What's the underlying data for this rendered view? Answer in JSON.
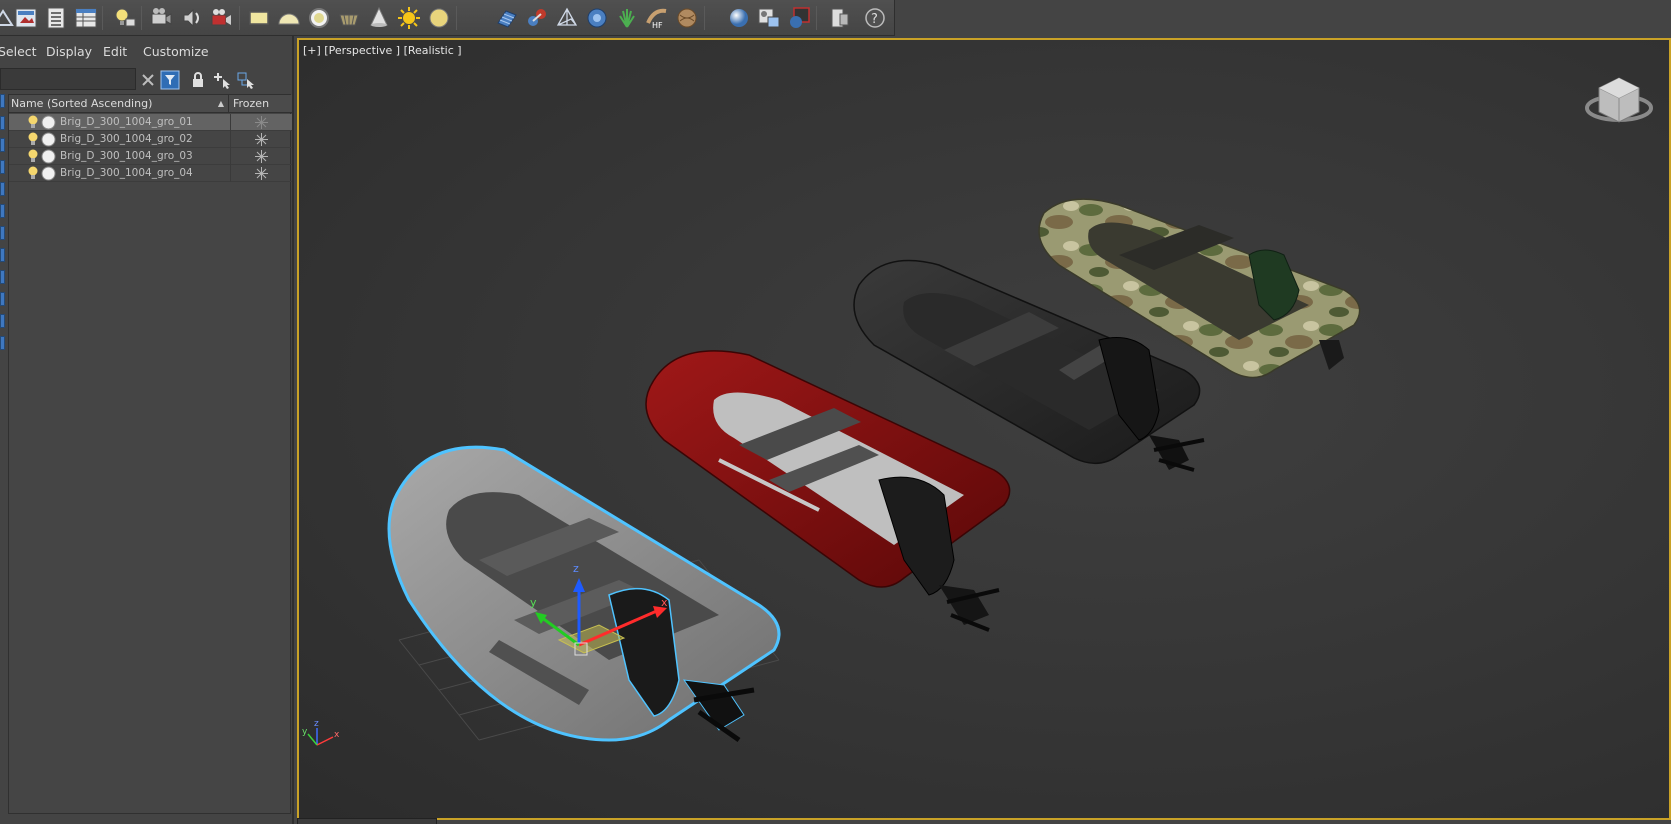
{
  "toolbar": {
    "icons": [
      "create-icon",
      "render-frame-icon",
      "list-icon",
      "grid-list-icon",
      "light-icon",
      "camera-icon",
      "audio-icon",
      "render-camera-icon",
      "rectangle-icon",
      "hemisphere-icon",
      "sphere-icon",
      "basket-icon",
      "cone-icon",
      "sun-icon",
      "disc-icon",
      "hatch-icon",
      "molecule-icon",
      "wire-pyramid-icon",
      "gear-flower-icon",
      "grass-icon",
      "hair-fur-icon",
      "wood-ball-icon",
      "material-sphere-icon",
      "material-editor-icon",
      "render-setup-icon",
      "docs-icon",
      "help-icon"
    ]
  },
  "menu": {
    "select": "Select",
    "display": "Display",
    "edit": "Edit",
    "customize": "Customize"
  },
  "search": {
    "value": ""
  },
  "explorer": {
    "col_name": "Name (Sorted Ascending)",
    "col_frozen": "Frozen",
    "rows": [
      {
        "name": "Brig_D_300_1004_gro_01",
        "selected": true
      },
      {
        "name": "Brig_D_300_1004_gro_02",
        "selected": false
      },
      {
        "name": "Brig_D_300_1004_gro_03",
        "selected": false
      },
      {
        "name": "Brig_D_300_1004_gro_04",
        "selected": false
      }
    ]
  },
  "viewport": {
    "label": "[+] [Perspective ] [Realistic ]",
    "active_border_color": "#c9a227",
    "selection_highlight_color": "#4fc3ff",
    "boats": [
      {
        "name": "grey-boat",
        "color": "#8e8e8e"
      },
      {
        "name": "red-boat",
        "color": "#8a1010"
      },
      {
        "name": "black-boat",
        "color": "#262626"
      },
      {
        "name": "camo-boat",
        "color": "#8a8a62"
      }
    ],
    "gizmo": {
      "x": "x",
      "y": "y",
      "z": "z"
    },
    "axis_tripod": {
      "x": "x",
      "y": "y",
      "z": "z"
    }
  }
}
